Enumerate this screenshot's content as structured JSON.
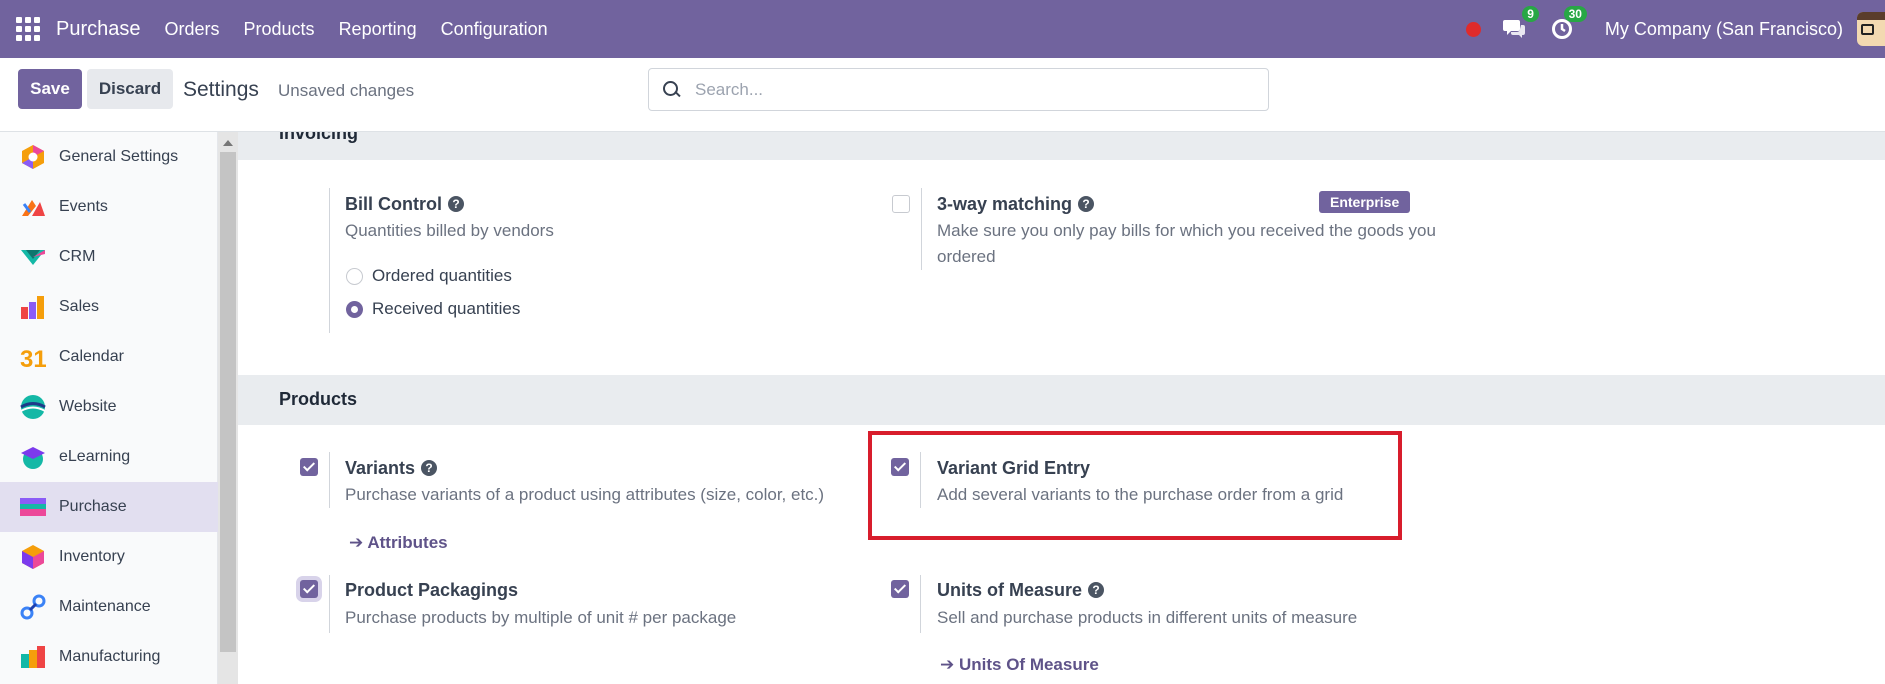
{
  "navbar": {
    "brand": "Purchase",
    "menu": [
      "Orders",
      "Products",
      "Reporting",
      "Configuration"
    ],
    "messages_count": "9",
    "activities_count": "30",
    "company": "My Company (San Francisco)"
  },
  "control": {
    "save_label": "Save",
    "discard_label": "Discard",
    "title": "Settings",
    "status": "Unsaved changes",
    "search_placeholder": "Search..."
  },
  "sidebar": {
    "items": [
      {
        "label": "General Settings",
        "icon": "general-settings-icon"
      },
      {
        "label": "Events",
        "icon": "events-icon"
      },
      {
        "label": "CRM",
        "icon": "crm-icon"
      },
      {
        "label": "Sales",
        "icon": "sales-icon"
      },
      {
        "label": "Calendar",
        "icon": "calendar-icon"
      },
      {
        "label": "Website",
        "icon": "website-icon"
      },
      {
        "label": "eLearning",
        "icon": "elearning-icon"
      },
      {
        "label": "Purchase",
        "icon": "purchase-icon",
        "active": true
      },
      {
        "label": "Inventory",
        "icon": "inventory-icon"
      },
      {
        "label": "Maintenance",
        "icon": "maintenance-icon"
      },
      {
        "label": "Manufacturing",
        "icon": "manufacturing-icon"
      }
    ],
    "calendar_glyph": "31"
  },
  "invoicing": {
    "title": "Invoicing",
    "bill_control": {
      "title": "Bill Control",
      "desc": "Quantities billed by vendors",
      "options": [
        "Ordered quantities",
        "Received quantities"
      ],
      "selected": "Received quantities"
    },
    "three_way": {
      "title": "3-way matching",
      "desc": "Make sure you only pay bills for which you received the goods you ordered",
      "badge": "Enterprise",
      "checked": false
    }
  },
  "products": {
    "title": "Products",
    "variants": {
      "title": "Variants",
      "desc": "Purchase variants of a product using attributes (size, color, etc.)",
      "link": "Attributes",
      "checked": true
    },
    "variant_grid": {
      "title": "Variant Grid Entry",
      "desc": "Add several variants to the purchase order from a grid",
      "checked": true
    },
    "packagings": {
      "title": "Product Packagings",
      "desc": "Purchase products by multiple of unit # per package",
      "checked": true
    },
    "uom": {
      "title": "Units of Measure",
      "desc": "Sell and purchase products in different units of measure",
      "link": "Units Of Measure",
      "checked": true
    }
  },
  "help_glyph": "?",
  "arrow_glyph": "➔",
  "colors": {
    "brand": "#71639e",
    "highlight": "#d81d2c",
    "badge_green": "#28a745"
  }
}
